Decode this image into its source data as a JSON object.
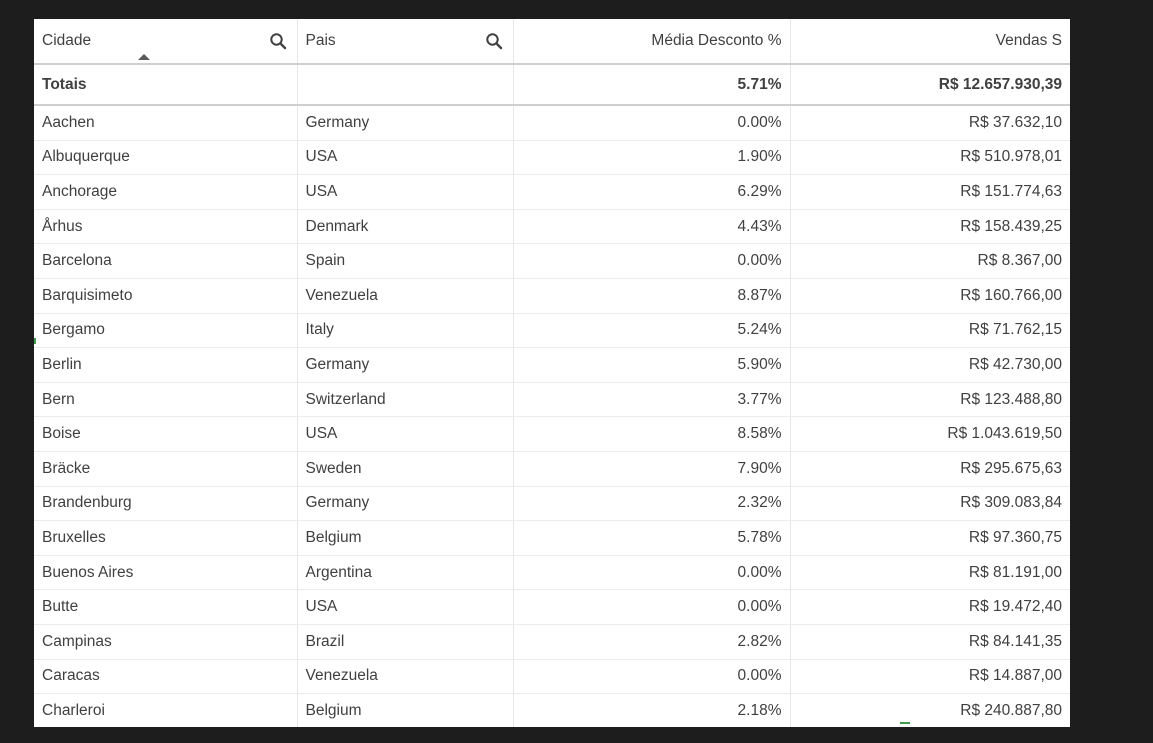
{
  "table": {
    "columns": [
      {
        "label": "Cidade"
      },
      {
        "label": "Pais"
      },
      {
        "label": "Média Desconto %"
      },
      {
        "label": "Vendas S"
      }
    ],
    "totals": {
      "label": "Totais",
      "pais": "",
      "media_desconto": "5.71%",
      "vendas": "R$ 12.657.930,39"
    },
    "rows": [
      {
        "cidade": "Aachen",
        "pais": "Germany",
        "media_desconto": "0.00%",
        "vendas": "R$ 37.632,10"
      },
      {
        "cidade": "Albuquerque",
        "pais": "USA",
        "media_desconto": "1.90%",
        "vendas": "R$ 510.978,01"
      },
      {
        "cidade": "Anchorage",
        "pais": "USA",
        "media_desconto": "6.29%",
        "vendas": "R$ 151.774,63"
      },
      {
        "cidade": "Århus",
        "pais": "Denmark",
        "media_desconto": "4.43%",
        "vendas": "R$ 158.439,25"
      },
      {
        "cidade": "Barcelona",
        "pais": "Spain",
        "media_desconto": "0.00%",
        "vendas": "R$ 8.367,00"
      },
      {
        "cidade": "Barquisimeto",
        "pais": "Venezuela",
        "media_desconto": "8.87%",
        "vendas": "R$ 160.766,00"
      },
      {
        "cidade": "Bergamo",
        "pais": "Italy",
        "media_desconto": "5.24%",
        "vendas": "R$ 71.762,15"
      },
      {
        "cidade": "Berlin",
        "pais": "Germany",
        "media_desconto": "5.90%",
        "vendas": "R$ 42.730,00"
      },
      {
        "cidade": "Bern",
        "pais": "Switzerland",
        "media_desconto": "3.77%",
        "vendas": "R$ 123.488,80"
      },
      {
        "cidade": "Boise",
        "pais": "USA",
        "media_desconto": "8.58%",
        "vendas": "R$ 1.043.619,50"
      },
      {
        "cidade": "Bräcke",
        "pais": "Sweden",
        "media_desconto": "7.90%",
        "vendas": "R$ 295.675,63"
      },
      {
        "cidade": "Brandenburg",
        "pais": "Germany",
        "media_desconto": "2.32%",
        "vendas": "R$ 309.083,84"
      },
      {
        "cidade": "Bruxelles",
        "pais": "Belgium",
        "media_desconto": "5.78%",
        "vendas": "R$ 97.360,75"
      },
      {
        "cidade": "Buenos Aires",
        "pais": "Argentina",
        "media_desconto": "0.00%",
        "vendas": "R$ 81.191,00"
      },
      {
        "cidade": "Butte",
        "pais": "USA",
        "media_desconto": "0.00%",
        "vendas": "R$ 19.472,40"
      },
      {
        "cidade": "Campinas",
        "pais": "Brazil",
        "media_desconto": "2.82%",
        "vendas": "R$ 84.141,35"
      },
      {
        "cidade": "Caracas",
        "pais": "Venezuela",
        "media_desconto": "0.00%",
        "vendas": "R$ 14.887,00"
      },
      {
        "cidade": "Charleroi",
        "pais": "Belgium",
        "media_desconto": "2.18%",
        "vendas": "R$ 240.887,80"
      }
    ]
  },
  "icons": {
    "search": "search-icon",
    "sort": "sort-ascending-icon"
  },
  "colors": {
    "background": "#1d1d1d",
    "panel": "#ffffff",
    "text": "#404040",
    "accent": "#3a9e4b"
  }
}
